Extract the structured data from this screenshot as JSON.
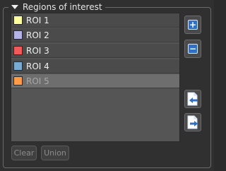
{
  "group": {
    "title": "Regions of interest"
  },
  "roi_list": [
    {
      "label": "ROI 1",
      "color": "#ffffa0",
      "selected": false
    },
    {
      "label": "ROI 2",
      "color": "#b4b4e6",
      "selected": false
    },
    {
      "label": "ROI 3",
      "color": "#f05a5a",
      "selected": false
    },
    {
      "label": "ROI 4",
      "color": "#78aad2",
      "selected": false
    },
    {
      "label": "ROI 5",
      "color": "#ff9b46",
      "selected": true
    }
  ],
  "side_buttons": {
    "add": {
      "icon": "add-roi-icon",
      "glyph": "+"
    },
    "remove": {
      "icon": "remove-roi-icon",
      "glyph": "−"
    },
    "import": {
      "icon": "import-icon"
    },
    "export": {
      "icon": "export-icon"
    }
  },
  "bottom_buttons": {
    "clear_label": "Clear",
    "union_label": "Union"
  },
  "colors": {
    "accent": "#2f6fc6"
  }
}
